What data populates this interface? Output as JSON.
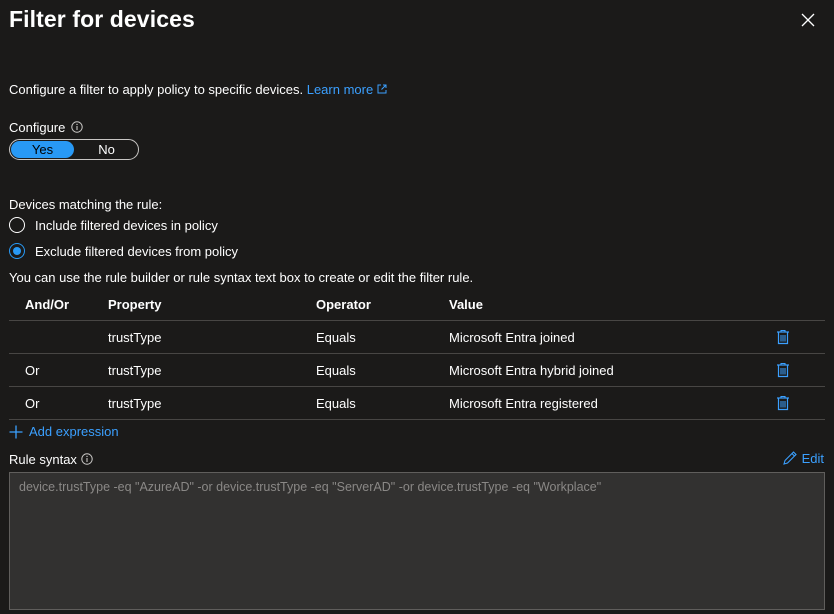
{
  "panel": {
    "title": "Filter for devices",
    "description": "Configure a filter to apply policy to specific devices.",
    "learn_more": "Learn more"
  },
  "configure": {
    "label": "Configure",
    "options": [
      "Yes",
      "No"
    ],
    "selected": "Yes"
  },
  "matching": {
    "label": "Devices matching the rule:",
    "options": [
      {
        "label": "Include filtered devices in policy",
        "checked": false
      },
      {
        "label": "Exclude filtered devices from policy",
        "checked": true
      }
    ]
  },
  "hint": "You can use the rule builder or rule syntax text box to create or edit the filter rule.",
  "table": {
    "headers": {
      "andor": "And/Or",
      "property": "Property",
      "operator": "Operator",
      "value": "Value"
    },
    "rows": [
      {
        "andor": "",
        "property": "trustType",
        "operator": "Equals",
        "value": "Microsoft Entra joined"
      },
      {
        "andor": "Or",
        "property": "trustType",
        "operator": "Equals",
        "value": "Microsoft Entra hybrid joined"
      },
      {
        "andor": "Or",
        "property": "trustType",
        "operator": "Equals",
        "value": "Microsoft Entra registered"
      }
    ]
  },
  "add_expression": "Add expression",
  "rule_syntax": {
    "label": "Rule syntax",
    "edit_label": "Edit",
    "text": "device.trustType -eq \"AzureAD\" -or device.trustType -eq \"ServerAD\" -or device.trustType -eq \"Workplace\""
  },
  "colors": {
    "background": "#1b1a19",
    "accent": "#2899f5",
    "link": "#3ba0ff",
    "divider": "#484644"
  },
  "icons": {
    "close": "close-icon",
    "external": "external-link-icon",
    "info": "info-icon",
    "delete": "trash-icon",
    "add": "plus-icon",
    "edit": "pencil-icon"
  }
}
